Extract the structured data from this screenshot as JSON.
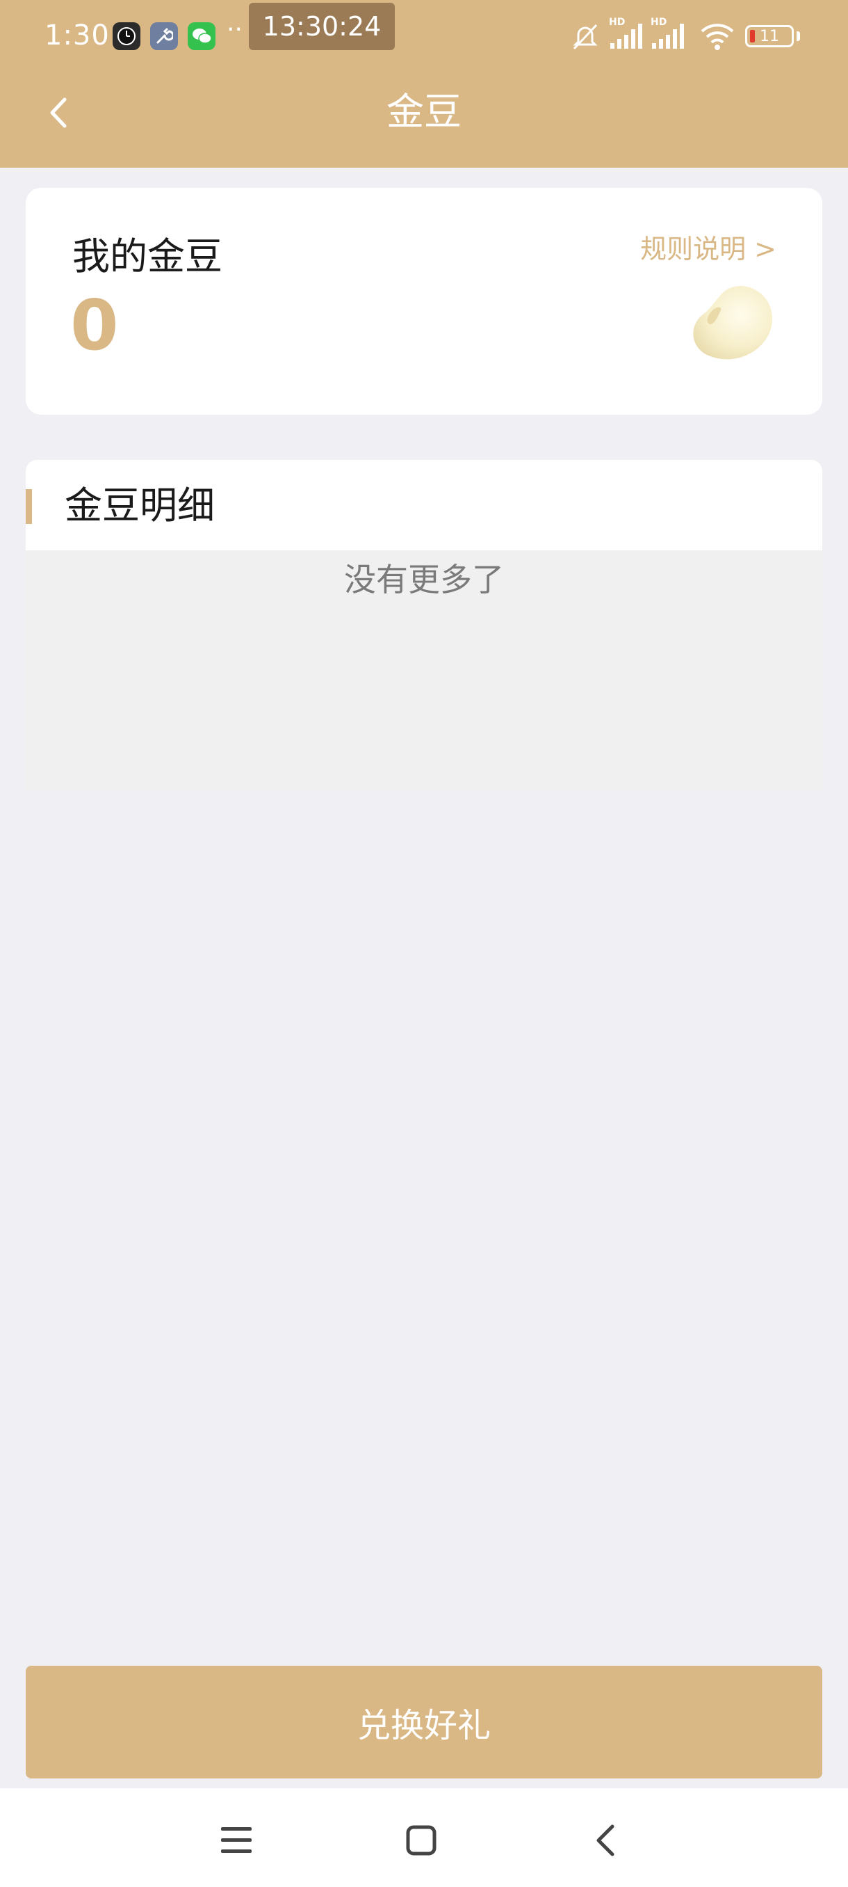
{
  "status_bar": {
    "time": "1:30",
    "more": "··",
    "clock_overlay": "13:30:24",
    "hd_1": "HD",
    "hd_2": "HD",
    "battery": "11"
  },
  "header": {
    "title": "金豆"
  },
  "balance_card": {
    "label": "我的金豆",
    "value": "0",
    "rules_link": "规则说明 >"
  },
  "details": {
    "title": "金豆明细",
    "empty_text": "没有更多了"
  },
  "redeem_button": {
    "label": "兑换好礼"
  },
  "colors": {
    "accent": "#d9b886",
    "background": "#efeff4",
    "empty_bg": "#f0f0f0"
  },
  "icons": {
    "back": "chevron-left-icon",
    "bean": "gold-bean-icon",
    "nav_menu": "menu-icon",
    "nav_home": "home-square-icon",
    "nav_back": "back-chevron-icon"
  }
}
